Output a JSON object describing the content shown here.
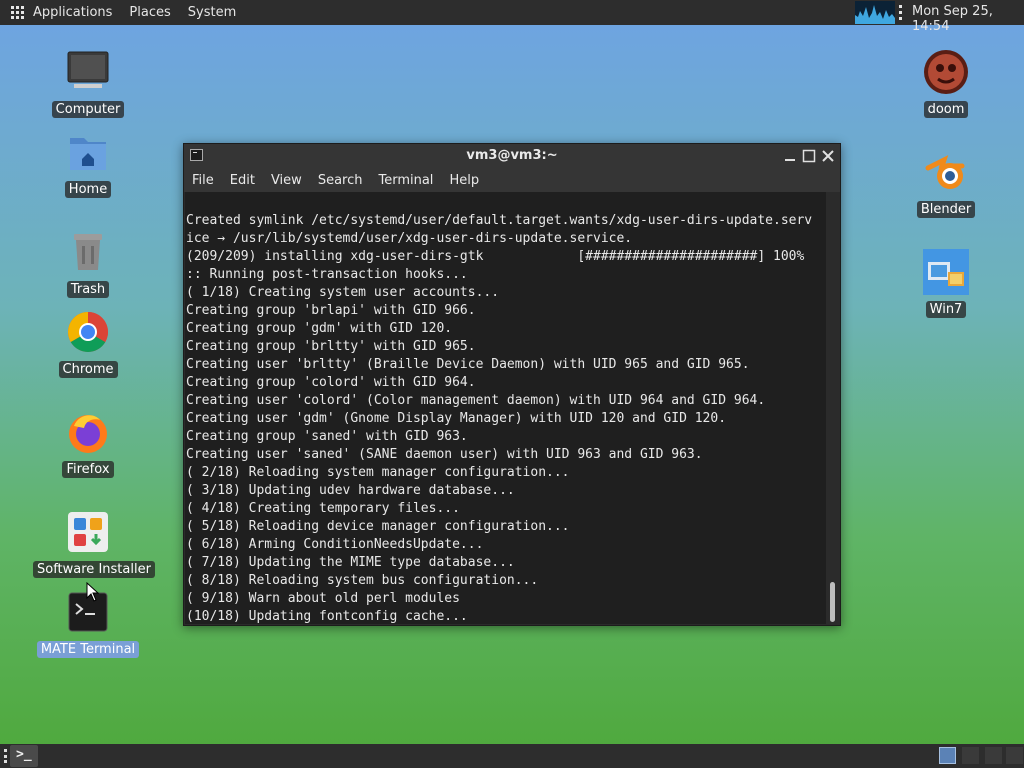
{
  "top_panel": {
    "menus": [
      "Applications",
      "Places",
      "System"
    ],
    "clock": "Mon Sep 25, 14:54"
  },
  "desktop_icons_left": [
    {
      "label": "Computer",
      "icon": "monitor-icon"
    },
    {
      "label": "Home",
      "icon": "home-folder-icon"
    },
    {
      "label": "Trash",
      "icon": "trash-icon"
    },
    {
      "label": "Chrome",
      "icon": "chrome-icon"
    },
    {
      "label": "Firefox",
      "icon": "firefox-icon"
    },
    {
      "label": "Software Installer",
      "icon": "software-installer-icon"
    },
    {
      "label": "MATE Terminal",
      "icon": "terminal-icon"
    }
  ],
  "desktop_icons_right": [
    {
      "label": "doom",
      "icon": "doom-icon"
    },
    {
      "label": "Blender",
      "icon": "blender-icon"
    },
    {
      "label": "Win7",
      "icon": "win7-icon"
    }
  ],
  "terminal": {
    "title": "vm3@vm3:~",
    "menu": [
      "File",
      "Edit",
      "View",
      "Search",
      "Terminal",
      "Help"
    ],
    "lines": [
      "Created symlink /etc/systemd/user/default.target.wants/xdg-user-dirs-update.serv",
      "ice → /usr/lib/systemd/user/xdg-user-dirs-update.service.",
      "(209/209) installing xdg-user-dirs-gtk            [######################] 100%",
      ":: Running post-transaction hooks...",
      "( 1/18) Creating system user accounts...",
      "Creating group 'brlapi' with GID 966.",
      "Creating group 'gdm' with GID 120.",
      "Creating group 'brltty' with GID 965.",
      "Creating user 'brltty' (Braille Device Daemon) with UID 965 and GID 965.",
      "Creating group 'colord' with GID 964.",
      "Creating user 'colord' (Color management daemon) with UID 964 and GID 964.",
      "Creating user 'gdm' (Gnome Display Manager) with UID 120 and GID 120.",
      "Creating group 'saned' with GID 963.",
      "Creating user 'saned' (SANE daemon user) with UID 963 and GID 963.",
      "( 2/18) Reloading system manager configuration...",
      "( 3/18) Updating udev hardware database...",
      "( 4/18) Creating temporary files...",
      "( 5/18) Reloading device manager configuration...",
      "( 6/18) Arming ConditionNeedsUpdate...",
      "( 7/18) Updating the MIME type database...",
      "( 8/18) Reloading system bus configuration...",
      "( 9/18) Warn about old perl modules",
      "(10/18) Updating fontconfig cache..."
    ]
  },
  "bottom_panel": {
    "task_label": ">_"
  }
}
